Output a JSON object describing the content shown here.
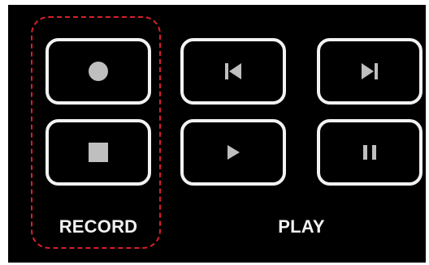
{
  "colors": {
    "background": "#000000",
    "button_border": "#f2f2f2",
    "icon_fill": "#bfbfbf",
    "record_highlight": "#d6202a"
  },
  "record": {
    "label": "RECORD",
    "buttons": [
      {
        "name": "record-button",
        "icon": "record-icon"
      },
      {
        "name": "stop-button",
        "icon": "stop-icon"
      }
    ]
  },
  "play": {
    "label": "PLAY",
    "buttons": [
      {
        "name": "previous-button",
        "icon": "skip-previous-icon"
      },
      {
        "name": "next-button",
        "icon": "skip-next-icon"
      },
      {
        "name": "play-button",
        "icon": "play-icon"
      },
      {
        "name": "pause-button",
        "icon": "pause-icon"
      }
    ]
  }
}
